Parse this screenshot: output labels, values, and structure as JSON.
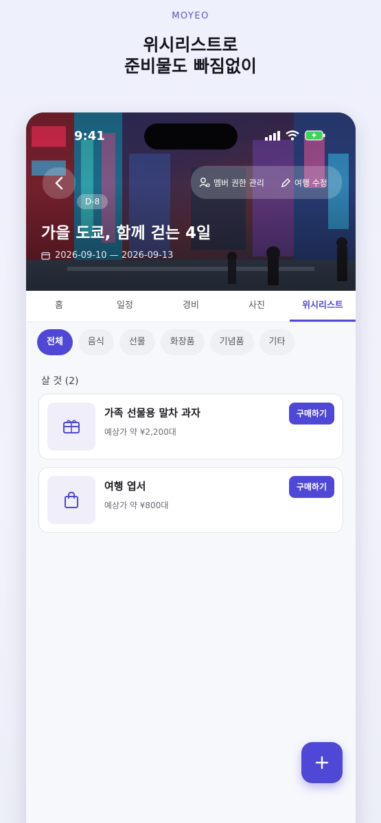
{
  "brand": "MOYEO",
  "headline": {
    "line1": "위시리스트로",
    "line2": "준비물도 빠짐없이"
  },
  "status_bar": {
    "time": "9:41"
  },
  "hero": {
    "badge": "D-8",
    "title": "가을 도쿄, 함께 걷는 4일",
    "dates": "2026-09-10 — 2026-09-13",
    "actions": {
      "members": "멤버 권한 관리",
      "edit": "여행 수정"
    }
  },
  "tabs": [
    {
      "label": "홈"
    },
    {
      "label": "일정"
    },
    {
      "label": "경비"
    },
    {
      "label": "사진"
    },
    {
      "label": "위시리스트",
      "active": true
    }
  ],
  "filters": [
    {
      "label": "전체",
      "active": true
    },
    {
      "label": "음식"
    },
    {
      "label": "선물"
    },
    {
      "label": "화장품"
    },
    {
      "label": "기념품"
    },
    {
      "label": "기타"
    }
  ],
  "section_title": "살 것 (2)",
  "items": [
    {
      "name": "가족 선물용 말차 과자",
      "price": "예상가 약 ¥2,200대",
      "button": "구매하기",
      "icon": "gift-card-icon"
    },
    {
      "name": "여행 엽서",
      "price": "예상가 약 ¥800대",
      "button": "구매하기",
      "icon": "shopping-bag-icon"
    }
  ],
  "colors": {
    "accent": "#4f47d6",
    "background": "#eef0fb"
  }
}
